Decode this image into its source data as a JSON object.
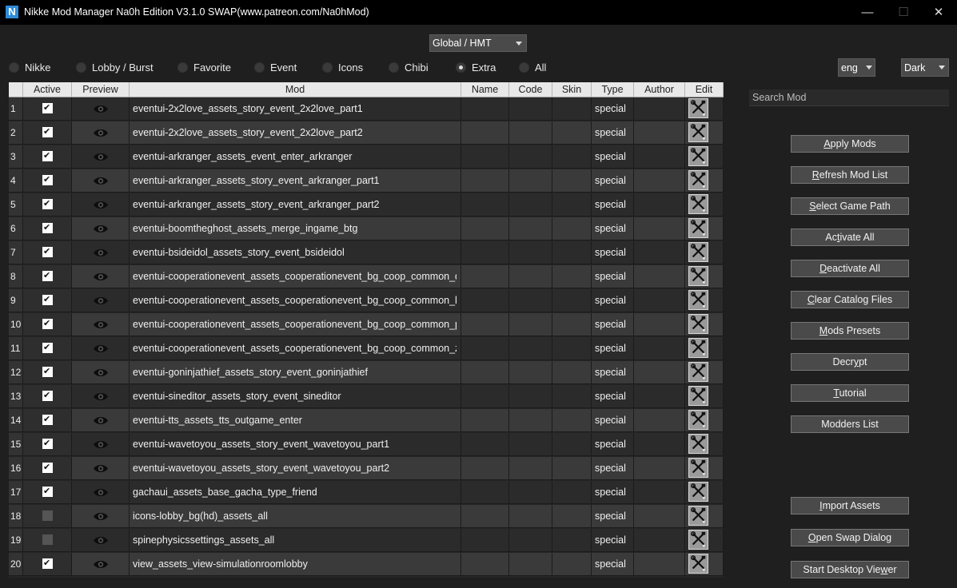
{
  "window": {
    "title": "Nikke Mod Manager Na0h Edition V3.1.0 SWAP(www.patreon.com/Na0hMod)",
    "logo_letter": "N",
    "min_glyph": "—",
    "max_glyph": "☐",
    "close_glyph": "✕"
  },
  "region": {
    "selected": "Global / HMT"
  },
  "filters": [
    {
      "label": "Nikke",
      "checked": false
    },
    {
      "label": "Lobby / Burst",
      "checked": false
    },
    {
      "label": "Favorite",
      "checked": false
    },
    {
      "label": "Event",
      "checked": false
    },
    {
      "label": "Icons",
      "checked": false
    },
    {
      "label": "Chibi",
      "checked": false
    },
    {
      "label": "Extra",
      "checked": true
    },
    {
      "label": "All",
      "checked": false
    }
  ],
  "language": {
    "selected": "eng"
  },
  "theme": {
    "selected": "Dark"
  },
  "table": {
    "columns": [
      "Active",
      "Preview",
      "Mod",
      "Name",
      "Code",
      "Skin",
      "Type",
      "Author",
      "Edit"
    ],
    "rows": [
      {
        "num": "1",
        "active": true,
        "mod": "eventui-2x2love_assets_story_event_2x2love_part1",
        "type": "special"
      },
      {
        "num": "2",
        "active": true,
        "mod": "eventui-2x2love_assets_story_event_2x2love_part2",
        "type": "special"
      },
      {
        "num": "3",
        "active": true,
        "mod": "eventui-arkranger_assets_event_enter_arkranger",
        "type": "special"
      },
      {
        "num": "4",
        "active": true,
        "mod": "eventui-arkranger_assets_story_event_arkranger_part1",
        "type": "special"
      },
      {
        "num": "5",
        "active": true,
        "mod": "eventui-arkranger_assets_story_event_arkranger_part2",
        "type": "special"
      },
      {
        "num": "6",
        "active": true,
        "mod": "eventui-boomtheghost_assets_merge_ingame_btg",
        "type": "special"
      },
      {
        "num": "7",
        "active": true,
        "mod": "eventui-bsideidol_assets_story_event_bsideidol",
        "type": "special"
      },
      {
        "num": "8",
        "active": true,
        "mod": "eventui-cooperationevent_assets_cooperationevent_bg_coop_common_dmtr",
        "type": "special"
      },
      {
        "num": "9",
        "active": true,
        "mod": "eventui-cooperationevent_assets_cooperationevent_bg_coop_common_hsta",
        "type": "special"
      },
      {
        "num": "10",
        "active": true,
        "mod": "eventui-cooperationevent_assets_cooperationevent_bg_coop_common_psid",
        "type": "special"
      },
      {
        "num": "11",
        "active": true,
        "mod": "eventui-cooperationevent_assets_cooperationevent_bg_coop_common_zeus",
        "type": "special"
      },
      {
        "num": "12",
        "active": true,
        "mod": "eventui-goninjathief_assets_story_event_goninjathief",
        "type": "special"
      },
      {
        "num": "13",
        "active": true,
        "mod": "eventui-sineditor_assets_story_event_sineditor",
        "type": "special"
      },
      {
        "num": "14",
        "active": true,
        "mod": "eventui-tts_assets_tts_outgame_enter",
        "type": "special"
      },
      {
        "num": "15",
        "active": true,
        "mod": "eventui-wavetoyou_assets_story_event_wavetoyou_part1",
        "type": "special"
      },
      {
        "num": "16",
        "active": true,
        "mod": "eventui-wavetoyou_assets_story_event_wavetoyou_part2",
        "type": "special"
      },
      {
        "num": "17",
        "active": true,
        "mod": "gachaui_assets_base_gacha_type_friend",
        "type": "special"
      },
      {
        "num": "18",
        "active": false,
        "mod": "icons-lobby_bg(hd)_assets_all",
        "type": "special"
      },
      {
        "num": "19",
        "active": false,
        "mod": "spinephysicssettings_assets_all",
        "type": "special"
      },
      {
        "num": "20",
        "active": true,
        "mod": "view_assets_view-simulationroomlobby",
        "type": "special"
      }
    ]
  },
  "search": {
    "placeholder": "Search Mod"
  },
  "buttons": {
    "apply": {
      "pre": "",
      "u": "A",
      "post": "pply Mods"
    },
    "refresh": {
      "pre": "",
      "u": "R",
      "post": "efresh Mod List"
    },
    "select_path": {
      "pre": "",
      "u": "S",
      "post": "elect Game Path"
    },
    "activate_all": {
      "pre": "Ac",
      "u": "t",
      "post": "ivate All"
    },
    "deactivate_all": {
      "pre": "",
      "u": "D",
      "post": "eactivate All"
    },
    "clear_catalog": {
      "pre": "",
      "u": "C",
      "post": "lear Catalog Files"
    },
    "presets": {
      "pre": "",
      "u": "M",
      "post": "ods Presets"
    },
    "decrypt": {
      "pre": "Decr",
      "u": "y",
      "post": "pt"
    },
    "tutorial": {
      "pre": "",
      "u": "T",
      "post": "utorial"
    },
    "modders": {
      "pre": "Modders List",
      "u": "",
      "post": ""
    },
    "import": {
      "pre": "",
      "u": "I",
      "post": "mport Assets"
    },
    "swap": {
      "pre": "",
      "u": "O",
      "post": "pen Swap Dialog"
    },
    "viewer": {
      "pre": "Start Desktop Vie",
      "u": "w",
      "post": "er"
    }
  }
}
